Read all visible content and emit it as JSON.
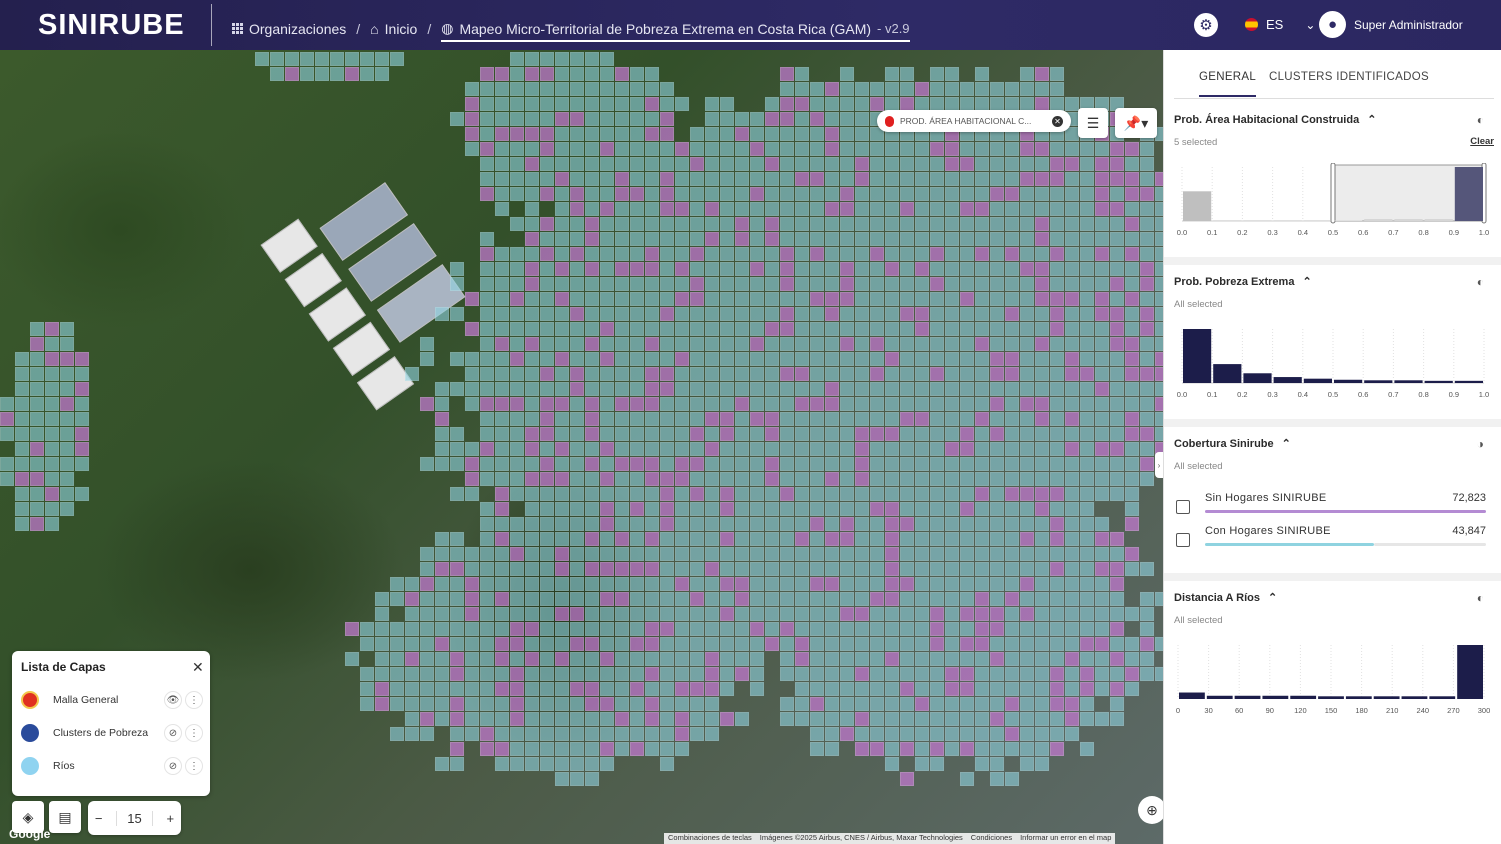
{
  "header": {
    "logo": "SINIRUBE",
    "breadcrumbs": [
      "Organizaciones",
      "Inicio",
      "Mapeo Micro-Territorial de Pobreza Extrema en Costa Rica (GAM)"
    ],
    "version": "v2.9",
    "language": "ES",
    "user_name": "Super Administrador",
    "icons": [
      "apps-grid-icon",
      "home-icon",
      "globe-icon",
      "gear-icon",
      "flag-es-icon",
      "chevron-down-icon",
      "user-avatar-icon"
    ]
  },
  "map": {
    "layer_chip": "PROD. ÁREA HABITACIONAL C...",
    "layer_list": {
      "title": "Lista de Capas",
      "items": [
        {
          "label": "Malla General",
          "color": "#e03020",
          "visible": true
        },
        {
          "label": "Clusters de Pobreza",
          "color": "#2a4b9b",
          "visible": false
        },
        {
          "label": "Ríos",
          "color": "#8fd3f0",
          "visible": false
        }
      ]
    },
    "zoom": "15",
    "zoom_minus": "−",
    "zoom_plus": "+",
    "google": "Google",
    "attribution": [
      "Combinaciones de teclas",
      "Imágenes ©2025 Airbus, CNES / Airbus, Maxar Technologies",
      "Condiciones",
      "Informar un error en el map"
    ],
    "colors": {
      "cell_blue": "#8fd3e0",
      "cell_purple": "#c77ad6"
    }
  },
  "panel": {
    "tabs": [
      "GENERAL",
      "CLUSTERS IDENTIFICADOS"
    ],
    "active_tab": "GENERAL",
    "sections": [
      {
        "title": "Prob. Área Habitacional Construida",
        "subtitle": "5 selected",
        "clear": "Clear",
        "ticks": [
          "0.0",
          "0.1",
          "0.2",
          "0.3",
          "0.4",
          "0.5",
          "0.6",
          "0.7",
          "0.8",
          "0.9",
          "1.0"
        ],
        "values": [
          0.55,
          0,
          0,
          0,
          0,
          0,
          0.01,
          0.01,
          0.02,
          1.0
        ],
        "selected_range": [
          0.5,
          1.0
        ]
      },
      {
        "title": "Prob. Pobreza Extrema",
        "subtitle": "All selected",
        "ticks": [
          "0.0",
          "0.1",
          "0.2",
          "0.3",
          "0.4",
          "0.5",
          "0.6",
          "0.7",
          "0.8",
          "0.9",
          "1.0"
        ],
        "values": [
          1.0,
          0.35,
          0.18,
          0.11,
          0.08,
          0.06,
          0.05,
          0.05,
          0.04,
          0.04
        ]
      },
      {
        "title": "Cobertura Sinirube",
        "subtitle": "All selected",
        "categories": [
          {
            "label": "Sin Hogares SINIRUBE",
            "value": "72,823",
            "share": 1.0,
            "color": "#b48bd3"
          },
          {
            "label": "Con Hogares SINIRUBE",
            "value": "43,847",
            "share": 0.6,
            "color": "#8fd3e0"
          }
        ]
      },
      {
        "title": "Distancia A Ríos",
        "subtitle": "All selected",
        "ticks": [
          "0",
          "30",
          "60",
          "90",
          "120",
          "150",
          "180",
          "210",
          "240",
          "270",
          "300"
        ],
        "values": [
          0.12,
          0.06,
          0.06,
          0.06,
          0.06,
          0.05,
          0.05,
          0.05,
          0.05,
          0.05,
          1.0
        ]
      }
    ]
  }
}
